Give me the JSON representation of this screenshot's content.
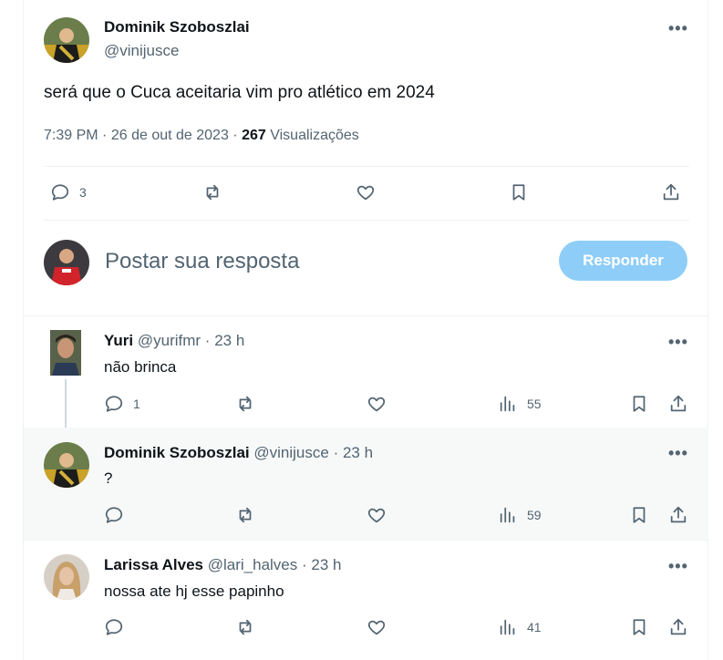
{
  "main_tweet": {
    "author_name": "Dominik Szoboszlai",
    "author_handle": "@vinijusce",
    "text": "será que o Cuca aceitaria vim pro atlético em 2024",
    "time": "7:39 PM",
    "date": "26 de out de 2023",
    "views_count": "267",
    "views_label": "Visualizações",
    "replies_count": "3"
  },
  "composer": {
    "placeholder": "Postar sua resposta",
    "reply_button": "Responder"
  },
  "replies": [
    {
      "name": "Yuri",
      "handle": "@yurifmr",
      "age": "23 h",
      "text": "não brinca",
      "replies": "1",
      "views": "55"
    },
    {
      "name": "Dominik Szoboszlai",
      "handle": "@vinijusce",
      "age": "23 h",
      "text": "?",
      "replies": "",
      "views": "59"
    },
    {
      "name": "Larissa Alves",
      "handle": "@lari_halves",
      "age": "23 h",
      "text": "nossa ate hj esse papinho",
      "replies": "",
      "views": "41"
    }
  ],
  "separator": "·",
  "more_label": "•••",
  "colors": {
    "accent_disabled": "#8ecdf8",
    "muted": "#536471",
    "divider": "#eff3f4"
  }
}
